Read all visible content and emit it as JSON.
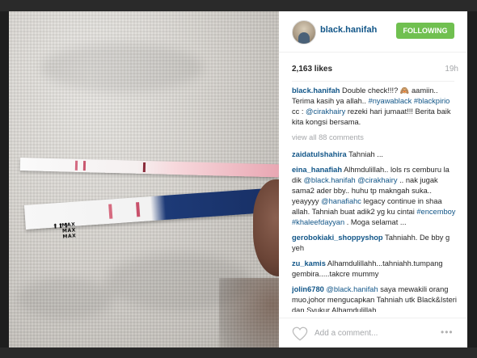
{
  "post": {
    "username": "black.hanifah",
    "follow_label": "FOLLOWING",
    "likes": "2,163 likes",
    "time": "19h",
    "caption": {
      "user": "black.hanifah",
      "text1": " Double check!!!? 🙈 aamiin.. Terima kasih ya allah.. ",
      "tag1": "#nyawablack",
      "tag2": "#blackpirio",
      "text2": " cc : ",
      "mention1": "@cirakhairy",
      "text3": " rezeki hari jumaat!!! Berita baik kita kongsi bersama."
    },
    "view_all": "view all 88 comments",
    "comments": [
      {
        "user": "zaidatulshahira",
        "text": " Tahniah ..."
      },
      {
        "user": "eina_hanafiah",
        "parts": [
          {
            "t": " Alhmdulillah.. lols rs cemburu la dik "
          },
          {
            "m": "@black.hanifah"
          },
          {
            "t": " "
          },
          {
            "m": "@cirakhairy"
          },
          {
            "t": " .. nak jugak sama2 ader bby.. huhu tp makngah suka.. yeayyyy "
          },
          {
            "m": "@hanafiahc"
          },
          {
            "t": " legacy continue in shaa allah. Tahniah buat adik2 yg ku cintai "
          },
          {
            "m": "#encemboy"
          },
          {
            "t": " "
          },
          {
            "m": "#khaleefdayyan"
          },
          {
            "t": " . Moga selamat ..."
          }
        ]
      },
      {
        "user": "gerobokiaki_shoppyshop",
        "text": " Tahniahh. De bby g yeh"
      },
      {
        "user": "zu_kamis",
        "text": " Alhamdulillahh...tahniahh.tumpang gembira.....takcre mummy"
      },
      {
        "user": "jolin6780",
        "parts": [
          {
            "t": " "
          },
          {
            "m": "@black.hanifah"
          },
          {
            "t": " saya mewakili orang muo,johor mengucapkan Tahniah utk Black&Isteri dan Syukur Alhamdulillah"
          }
        ]
      }
    ],
    "add_comment_placeholder": "Add a comment...",
    "more_label": "•••"
  },
  "photo": {
    "labels": [
      "MAX",
      "MAX",
      "MAX"
    ],
    "arrows": "⬆⬆⬆"
  }
}
